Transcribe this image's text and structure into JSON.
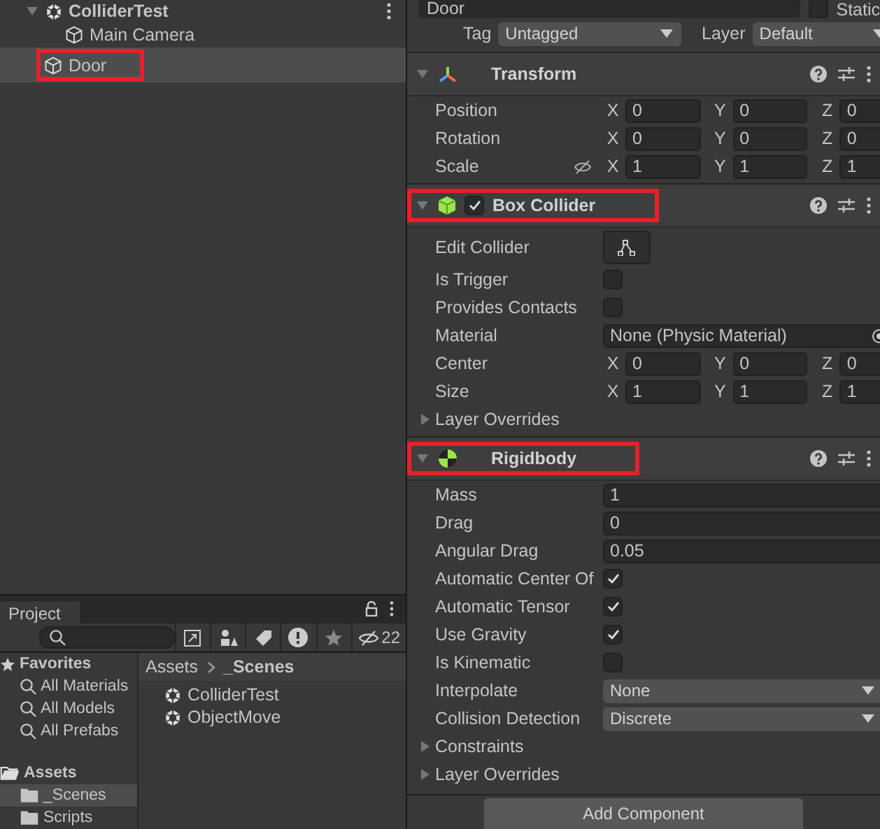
{
  "hierarchy": {
    "scene": {
      "label": "ColliderTest",
      "expanded": true,
      "children": [
        {
          "label": "Main Camera",
          "selected": false,
          "highlighted": false
        },
        {
          "label": "Door",
          "selected": true,
          "highlighted": true
        }
      ]
    }
  },
  "project": {
    "tab": "Project",
    "hidden_count": "22",
    "favorites": {
      "label": "Favorites",
      "items": [
        "All Materials",
        "All Models",
        "All Prefabs"
      ]
    },
    "assets": {
      "label": "Assets",
      "folders": [
        {
          "label": "_Scenes",
          "selected": true
        },
        {
          "label": "Scripts",
          "selected": false
        }
      ]
    },
    "breadcrumb": [
      "Assets",
      "_Scenes"
    ],
    "files": [
      "ColliderTest",
      "ObjectMove"
    ]
  },
  "inspector": {
    "object_name": "Door",
    "static_label": "Static",
    "static_checked": false,
    "tag_label": "Tag",
    "tag_value": "Untagged",
    "layer_label": "Layer",
    "layer_value": "Default",
    "components": [
      {
        "title": "Transform",
        "kind": "transform",
        "highlighted": false,
        "expanded": true,
        "rows": [
          {
            "kind": "vector",
            "label": "Position",
            "proportional": false,
            "axes": [
              {
                "axis": "X",
                "value": "0"
              },
              {
                "axis": "Y",
                "value": "0"
              },
              {
                "axis": "Z",
                "value": "0"
              }
            ]
          },
          {
            "kind": "vector",
            "label": "Rotation",
            "proportional": false,
            "axes": [
              {
                "axis": "X",
                "value": "0"
              },
              {
                "axis": "Y",
                "value": "0"
              },
              {
                "axis": "Z",
                "value": "0"
              }
            ]
          },
          {
            "kind": "vector",
            "label": "Scale",
            "proportional": true,
            "axes": [
              {
                "axis": "X",
                "value": "1"
              },
              {
                "axis": "Y",
                "value": "1"
              },
              {
                "axis": "Z",
                "value": "1"
              }
            ]
          }
        ]
      },
      {
        "title": "Box Collider",
        "kind": "box_collider",
        "enabled": true,
        "highlighted": true,
        "expanded": true,
        "rows": [
          {
            "kind": "edit",
            "label": "Edit Collider"
          },
          {
            "kind": "checkbox",
            "label": "Is Trigger",
            "checked": false
          },
          {
            "kind": "checkbox",
            "label": "Provides Contacts",
            "checked": false
          },
          {
            "kind": "object",
            "label": "Material",
            "value": "None (Physic Material)"
          },
          {
            "kind": "vector",
            "label": "Center",
            "proportional": false,
            "axes": [
              {
                "axis": "X",
                "value": "0"
              },
              {
                "axis": "Y",
                "value": "0"
              },
              {
                "axis": "Z",
                "value": "0"
              }
            ]
          },
          {
            "kind": "vector",
            "label": "Size",
            "proportional": false,
            "axes": [
              {
                "axis": "X",
                "value": "1"
              },
              {
                "axis": "Y",
                "value": "1"
              },
              {
                "axis": "Z",
                "value": "1"
              }
            ]
          },
          {
            "kind": "foldout",
            "label": "Layer Overrides",
            "expanded": false
          }
        ]
      },
      {
        "title": "Rigidbody",
        "kind": "rigidbody",
        "highlighted": true,
        "expanded": true,
        "rows": [
          {
            "kind": "field",
            "label": "Mass",
            "value": "1"
          },
          {
            "kind": "field",
            "label": "Drag",
            "value": "0"
          },
          {
            "kind": "field",
            "label": "Angular Drag",
            "value": "0.05"
          },
          {
            "kind": "checkbox",
            "label": "Automatic Center Of",
            "checked": true
          },
          {
            "kind": "checkbox",
            "label": "Automatic Tensor",
            "checked": true
          },
          {
            "kind": "checkbox",
            "label": "Use Gravity",
            "checked": true
          },
          {
            "kind": "checkbox",
            "label": "Is Kinematic",
            "checked": false
          },
          {
            "kind": "dropdown",
            "label": "Interpolate",
            "value": "None"
          },
          {
            "kind": "dropdown",
            "label": "Collision Detection",
            "value": "Discrete"
          },
          {
            "kind": "foldout",
            "label": "Constraints",
            "expanded": false
          },
          {
            "kind": "foldout",
            "label": "Layer Overrides",
            "expanded": false
          }
        ]
      }
    ],
    "add_button": "Add Component"
  }
}
